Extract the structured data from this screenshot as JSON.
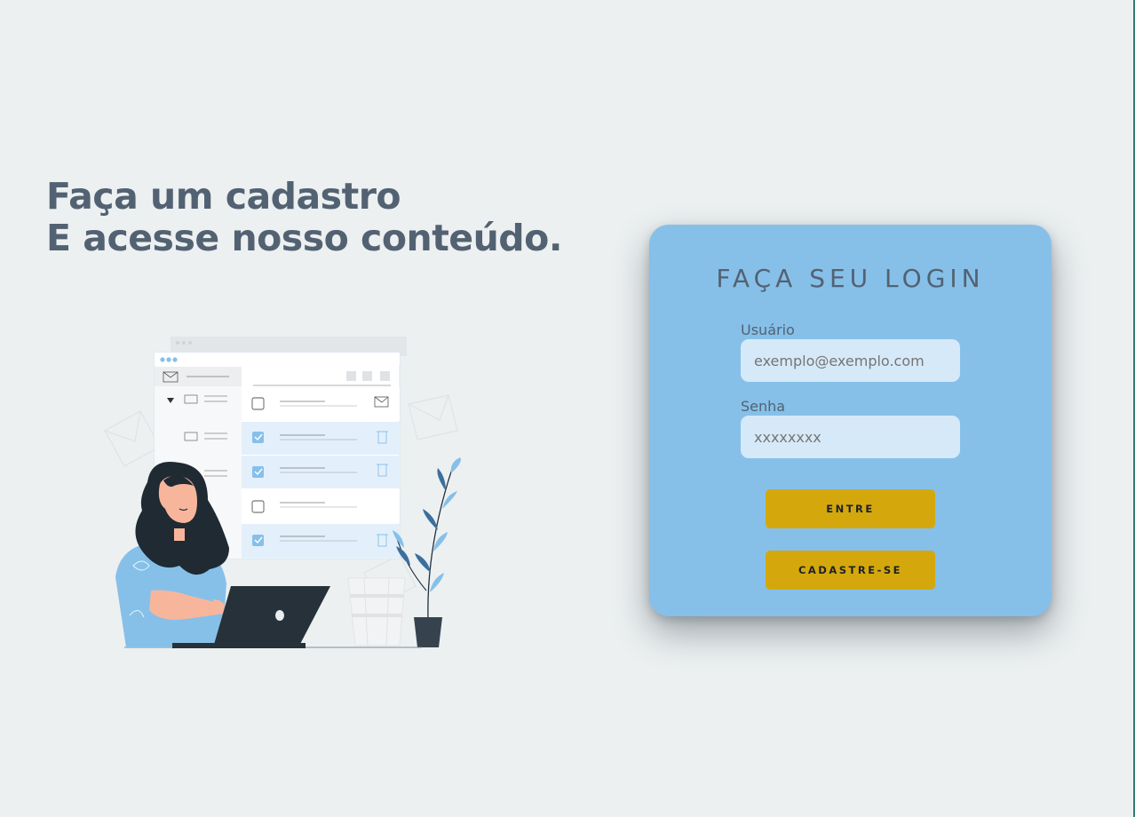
{
  "headline": {
    "line1": "Faça um cadastro",
    "line2": "E acesse nosso conteúdo."
  },
  "login": {
    "title": "FAÇA SEU LOGIN",
    "user_label": "Usuário",
    "user_placeholder": "exemplo@exemplo.com",
    "password_label": "Senha",
    "password_placeholder": "xxxxxxxx",
    "enter_label": "ENTRE",
    "signup_label": "CADASTRE-SE"
  },
  "colors": {
    "background": "#ecf0f1",
    "card": "#86c0e9",
    "heading": "#536272",
    "input": "#d6e9f8",
    "button": "#d4a80c"
  },
  "illustration": {
    "name": "woman-with-laptop-email-illustration"
  }
}
